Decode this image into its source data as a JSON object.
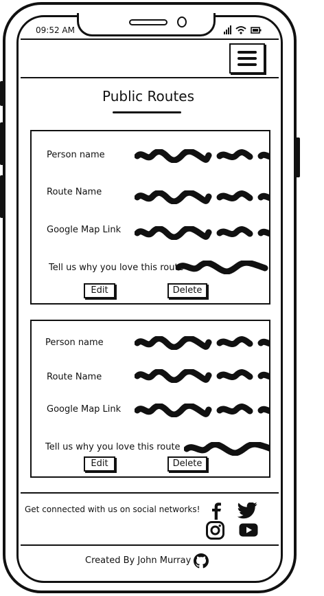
{
  "status_bar": {
    "time": "09:52 AM"
  },
  "page": {
    "title": "Public Routes"
  },
  "routes": [
    {
      "person_label": "Person name",
      "route_label": "Route Name",
      "map_label": "Google Map Link",
      "why_label": "Tell us why you love this route",
      "edit_label": "Edit",
      "delete_label": "Delete"
    },
    {
      "person_label": "Person name",
      "route_label": "Route Name",
      "map_label": "Google Map Link",
      "why_label": "Tell us why you love this route",
      "edit_label": "Edit",
      "delete_label": "Delete"
    }
  ],
  "footer": {
    "social_text": "Get connected with us on social networks!",
    "credit": "Created By John Murray",
    "icons": [
      "facebook-icon",
      "twitter-icon",
      "instagram-icon",
      "youtube-icon",
      "github-icon"
    ]
  }
}
